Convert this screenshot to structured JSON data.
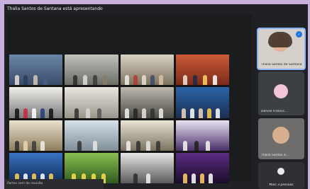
{
  "meeting": {
    "presenting_text": "Thalia Santos de Santana está apresentando",
    "bottom_label": "Partes sem de reunião"
  },
  "participants": [
    {
      "name": "Thalia Santos de Santana",
      "role": "self"
    },
    {
      "name": "Denise Francis...",
      "role": "participant"
    },
    {
      "name": "Thalia Santos d...",
      "role": "participant"
    }
  ],
  "more_people": {
    "label": "Mais 3 pessoas"
  },
  "colors": {
    "background": "#c7b0d9",
    "app": "#202124",
    "accent": "#1a73e8"
  },
  "icons": [
    "mic-off-icon",
    "people-icon"
  ]
}
